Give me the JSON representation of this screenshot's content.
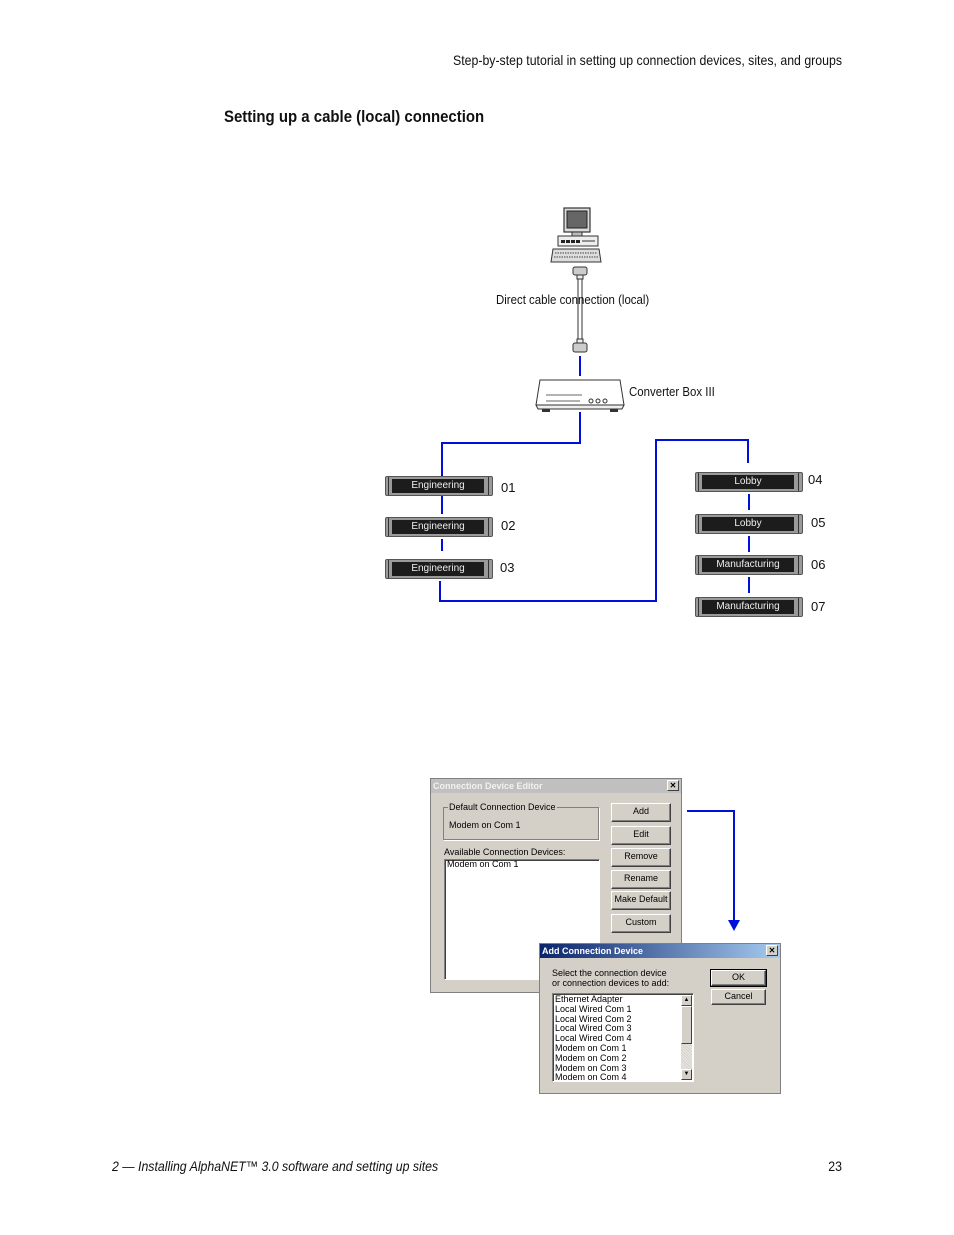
{
  "page": {
    "running_head": "Step-by-step tutorial in setting up connection devices, sites, and groups",
    "section_title": "Setting up a cable (local) connection",
    "footer_left": "2 — Installing AlphaNET™ 3.0 software and setting up sites",
    "page_number": "23"
  },
  "diagram": {
    "computer_label": "Direct cable connection (local)",
    "converter_label": "Converter Box III",
    "wire_color": "#0010d8",
    "signs_left": [
      {
        "text": "Engineering",
        "number": "01"
      },
      {
        "text": "Engineering",
        "number": "02"
      },
      {
        "text": "Engineering",
        "number": "03"
      }
    ],
    "signs_right": [
      {
        "text": "Lobby",
        "number": "04"
      },
      {
        "text": "Lobby",
        "number": "05"
      },
      {
        "text": "Manufacturing",
        "number": "06"
      },
      {
        "text": "Manufacturing",
        "number": "07"
      }
    ]
  },
  "editor_dialog": {
    "title": "Connection Device Editor",
    "close_glyph": "✕",
    "default_group_label": "Default Connection Device",
    "default_value": "Modem on Com 1",
    "available_label": "Available Connection Devices:",
    "available_items": [
      "Modem on Com 1"
    ],
    "buttons": [
      "Add",
      "Edit",
      "Remove",
      "Rename",
      "Make Default",
      "Custom"
    ]
  },
  "add_dialog": {
    "title": "Add Connection Device",
    "close_glyph": "✕",
    "prompt_line1": "Select the connection device",
    "prompt_line2": "or connection devices to add:",
    "items": [
      "Ethernet Adapter",
      "Local Wired Com 1",
      "Local Wired Com 2",
      "Local Wired Com 3",
      "Local Wired Com 4",
      "Modem on Com 1",
      "Modem on Com 2",
      "Modem on Com 3",
      "Modem on Com 4"
    ],
    "ok_label": "OK",
    "cancel_label": "Cancel",
    "scroll_up": "▲",
    "scroll_down": "▼"
  }
}
